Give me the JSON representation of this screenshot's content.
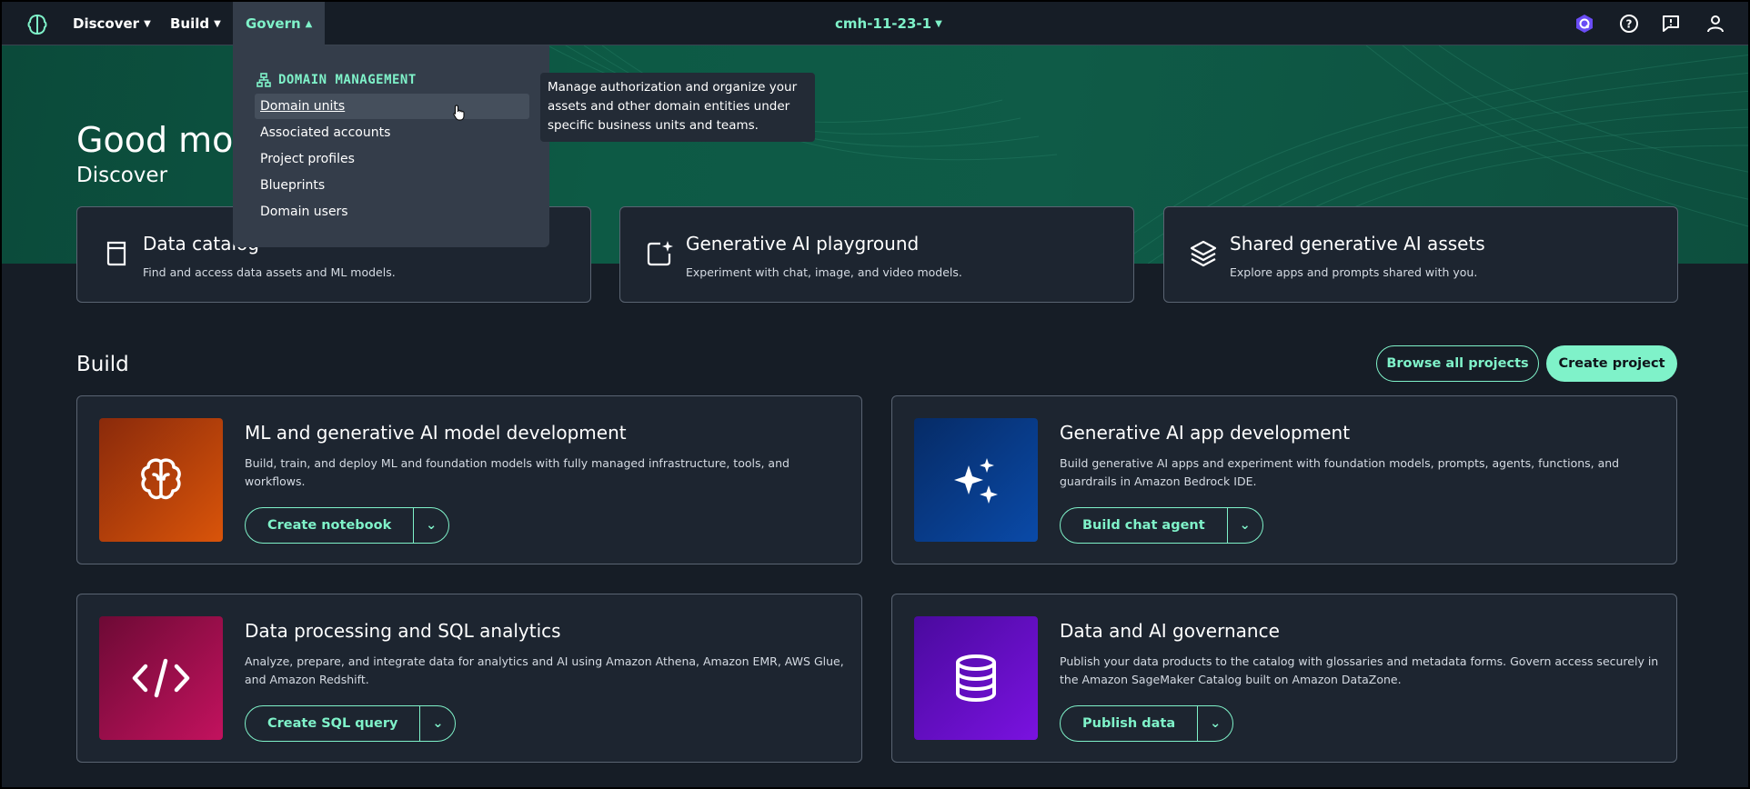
{
  "nav": {
    "discover": "Discover",
    "build": "Build",
    "govern": "Govern",
    "domain": "cmh-11-23-1"
  },
  "greeting": "Good morn",
  "discover": {
    "title": "Discover",
    "cards": [
      {
        "title": "Data catalog",
        "desc": "Find and access data assets and ML models.",
        "icon": "book-icon"
      },
      {
        "title": "Generative AI playground",
        "desc": "Experiment with chat, image, and video models.",
        "icon": "chat-sparkle-icon"
      },
      {
        "title": "Shared generative AI assets",
        "desc": "Explore apps and prompts shared with you.",
        "icon": "layers-icon"
      }
    ]
  },
  "build": {
    "title": "Build",
    "browse_label": "Browse all projects",
    "create_label": "Create project",
    "cards": [
      {
        "title": "ML and generative AI model development",
        "desc": "Build, train, and deploy ML and foundation models with fully managed infrastructure, tools, and workflows.",
        "action": "Create notebook",
        "icon": "brain-icon",
        "color_start": "#8a2a0b",
        "color_end": "#d9540a"
      },
      {
        "title": "Generative AI app development",
        "desc": "Build generative AI apps and experiment with foundation models, prompts, agents, functions, and guardrails in Amazon Bedrock IDE.",
        "action": "Build chat agent",
        "icon": "sparkles-icon",
        "color_start": "#062b66",
        "color_end": "#0a4aa8"
      },
      {
        "title": "Data processing and SQL analytics",
        "desc": "Analyze, prepare, and integrate data for analytics and AI using Amazon Athena, Amazon EMR, AWS Glue, and Amazon Redshift.",
        "action": "Create SQL query",
        "icon": "code-icon",
        "color_start": "#6d0a35",
        "color_end": "#c2125e"
      },
      {
        "title": "Data and AI governance",
        "desc": "Publish your data products to the catalog with glossaries and metadata forms. Govern access securely in the Amazon SageMaker Catalog built on Amazon DataZone.",
        "action": "Publish data",
        "icon": "database-icon",
        "color_start": "#4a0a9e",
        "color_end": "#7a12e0"
      }
    ]
  },
  "govern_menu": {
    "heading": "DOMAIN MANAGEMENT",
    "items": [
      "Domain units",
      "Associated accounts",
      "Project profiles",
      "Blueprints",
      "Domain users"
    ],
    "tooltip": "Manage authorization and organize your assets and other domain entities under specific business units and teams."
  },
  "colors": {
    "accent": "#7ff2c9",
    "background": "#161d26",
    "card": "#1d2530"
  }
}
